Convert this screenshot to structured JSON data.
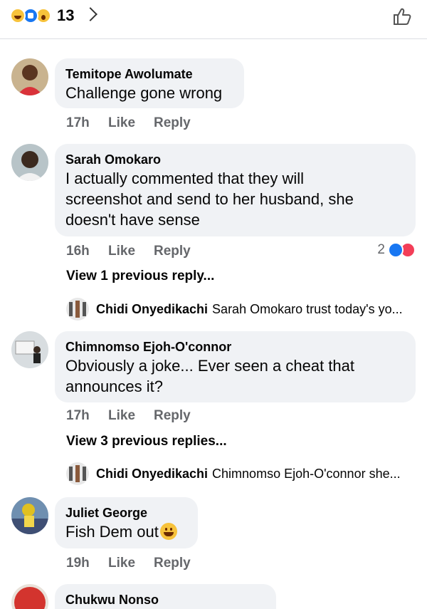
{
  "header": {
    "reaction_icons": [
      "laugh-emoji-icon",
      "like-reaction-icon",
      "wow-emoji-icon"
    ],
    "reaction_count": "13",
    "like_icon": "thumbs-up-outline-icon"
  },
  "comments": [
    {
      "author": "Temitope Awolumate",
      "text": "Challenge gone wrong",
      "time": "17h",
      "like_label": "Like",
      "reply_label": "Reply"
    },
    {
      "author": "Sarah Omokaro",
      "text_lines": [
        "I actually commented that they will",
        "screenshot and send to her husband, she",
        "doesn't have sense"
      ],
      "time": "16h",
      "like_label": "Like",
      "reply_label": "Reply",
      "reaction_count": "2",
      "view_replies": "View 1 previous reply...",
      "reply_preview": {
        "author": "Chidi Onyedikachi",
        "text": "Sarah Omokaro trust today's yo..."
      }
    },
    {
      "author": "Chimnomso Ejoh-O'connor",
      "text_lines": [
        "Obviously a joke... Ever seen a cheat that",
        "announces it?"
      ],
      "time": "17h",
      "like_label": "Like",
      "reply_label": "Reply",
      "view_replies": "View 3 previous replies...",
      "reply_preview": {
        "author": "Chidi Onyedikachi",
        "text": "Chimnomso Ejoh-O'connor she..."
      }
    },
    {
      "author": "Juliet George",
      "text": "Fish Dem out",
      "time": "19h",
      "like_label": "Like",
      "reply_label": "Reply"
    },
    {
      "author": "Chukwu Nonso"
    }
  ],
  "colors": {
    "accent": "#1877f2",
    "bubble": "#f0f2f5",
    "meta": "#65676b"
  }
}
